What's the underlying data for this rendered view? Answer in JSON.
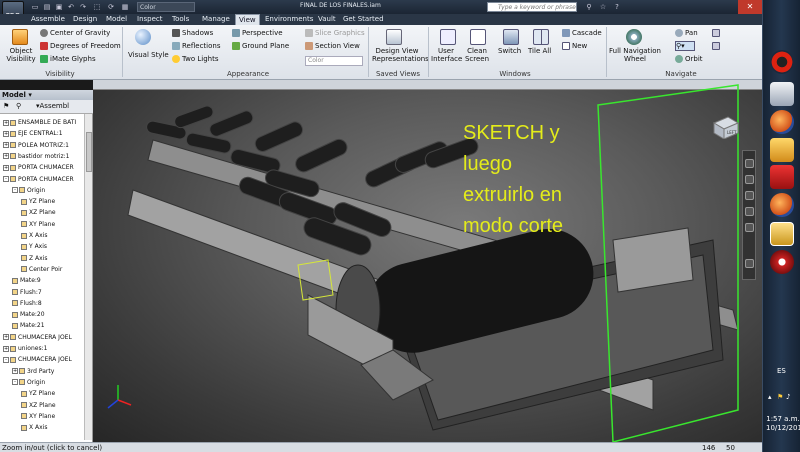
{
  "titlebar": {
    "app_label": "PRO",
    "color_dropdown": "Color",
    "document_title": "FINAL DE LOS FINALES.iam",
    "search_placeholder": "Type a keyword or phrase"
  },
  "menu": {
    "tabs": [
      "Assemble",
      "Design",
      "Model",
      "Inspect",
      "Tools",
      "Manage",
      "View",
      "Environments",
      "Vault",
      "Get Started"
    ],
    "active": "View"
  },
  "ribbon": {
    "visibility": {
      "label": "Visibility",
      "object_visibility": "Object\nVisibility",
      "center_of_gravity": "Center of Gravity",
      "degrees_of_freedom": "Degrees of Freedom",
      "imate_glyphs": "iMate Glyphs"
    },
    "appearance": {
      "label": "Appearance",
      "visual_style": "Visual Style",
      "shadows": "Shadows",
      "reflections": "Reflections",
      "two_lights": "Two Lights",
      "perspective": "Perspective",
      "ground_plane": "Ground Plane",
      "slice_graphics": "Slice Graphics",
      "section_view": "Section View",
      "color": "Color"
    },
    "saved_views": {
      "label": "Saved Views",
      "design_view": "Design View\nRepresentations"
    },
    "windows": {
      "label": "Windows",
      "user_interface": "User\nInterface",
      "clean_screen": "Clean\nScreen",
      "switch": "Switch",
      "tile_all": "Tile All",
      "cascade": "Cascade",
      "new": "New"
    },
    "navigate": {
      "label": "Navigate",
      "full_nav_wheel": "Full Navigation\nWheel",
      "pan": "Pan",
      "orbit": "Orbit"
    }
  },
  "browser": {
    "title": "Model",
    "toolbar_label": "Assembl",
    "items": [
      {
        "label": "ENSAMBLE DE BATI",
        "indent": 0,
        "exp": "+"
      },
      {
        "label": "EJE CENTRAL:1",
        "indent": 0,
        "exp": "+"
      },
      {
        "label": "POLEA MOTRIZ:1",
        "indent": 0,
        "exp": "+"
      },
      {
        "label": "bastidor motriz:1",
        "indent": 0,
        "exp": "+"
      },
      {
        "label": "PORTA CHUMACER",
        "indent": 0,
        "exp": "+"
      },
      {
        "label": "PORTA CHUMACER",
        "indent": 0,
        "exp": "-"
      },
      {
        "label": "Origin",
        "indent": 1,
        "exp": "-"
      },
      {
        "label": "YZ Plane",
        "indent": 2,
        "exp": ""
      },
      {
        "label": "XZ Plane",
        "indent": 2,
        "exp": ""
      },
      {
        "label": "XY Plane",
        "indent": 2,
        "exp": ""
      },
      {
        "label": "X Axis",
        "indent": 2,
        "exp": ""
      },
      {
        "label": "Y Axis",
        "indent": 2,
        "exp": ""
      },
      {
        "label": "Z Axis",
        "indent": 2,
        "exp": ""
      },
      {
        "label": "Center Poir",
        "indent": 2,
        "exp": ""
      },
      {
        "label": "Mate:9",
        "indent": 1,
        "exp": ""
      },
      {
        "label": "Flush:7",
        "indent": 1,
        "exp": ""
      },
      {
        "label": "Flush:8",
        "indent": 1,
        "exp": ""
      },
      {
        "label": "Mate:20",
        "indent": 1,
        "exp": ""
      },
      {
        "label": "Mate:21",
        "indent": 1,
        "exp": ""
      },
      {
        "label": "CHUMACERA JOEL",
        "indent": 0,
        "exp": "+"
      },
      {
        "label": "uniones:1",
        "indent": 0,
        "exp": "+"
      },
      {
        "label": "CHUMACERA JOEL",
        "indent": 0,
        "exp": "-"
      },
      {
        "label": "3rd Party",
        "indent": 1,
        "exp": "+"
      },
      {
        "label": "Origin",
        "indent": 1,
        "exp": "-"
      },
      {
        "label": "YZ Plane",
        "indent": 2,
        "exp": ""
      },
      {
        "label": "XZ Plane",
        "indent": 2,
        "exp": ""
      },
      {
        "label": "XY Plane",
        "indent": 2,
        "exp": ""
      },
      {
        "label": "X Axis",
        "indent": 2,
        "exp": ""
      }
    ]
  },
  "viewport": {
    "annotation": "SKETCH  y\nluego\nextruirlo en\nmodo corte",
    "annotation_color": "#e4ec1a",
    "viewcube_label": "LEFT"
  },
  "status": {
    "message": "Zoom in/out (click to cancel)",
    "count1": "146",
    "count2": "50"
  },
  "taskbar": {
    "language": "ES",
    "time": "1:57 a.m.",
    "date": "10/12/2011"
  }
}
